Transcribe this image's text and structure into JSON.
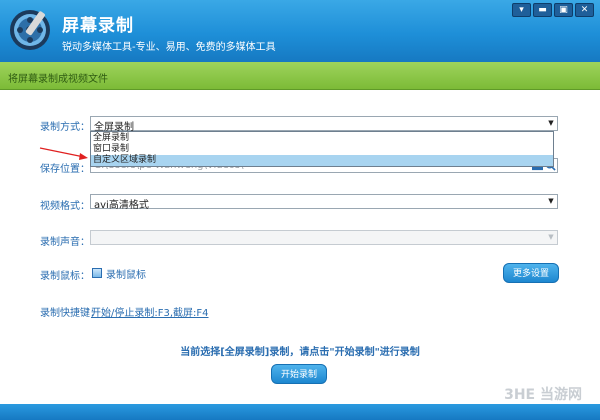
{
  "app": {
    "title": "屏幕录制",
    "subtitle": "锐动多媒体工具-专业、易用、免费的多媒体工具"
  },
  "window_controls": {
    "menu": "▾",
    "minimize": "▬",
    "restore": "▣",
    "close": "✕"
  },
  "section": {
    "title": "将屏幕录制成视频文件"
  },
  "form": {
    "record_mode": {
      "label": "录制方式：",
      "value": "全屏录制",
      "options": [
        "全屏录制",
        "窗口录制",
        "自定义区域录制"
      ],
      "highlighted": "自定义区域录制"
    },
    "save_location": {
      "label": "保存位置：",
      "value": "C:\\Users\\pe Wanweng\\Videos\\"
    },
    "video_format": {
      "label": "视频格式：",
      "value": "avi高清格式"
    },
    "audio": {
      "label": "录制声音：",
      "value": ""
    },
    "cursor": {
      "label": "录制鼠标：",
      "checkbox_label": "录制鼠标",
      "checked": true
    },
    "more_settings_button": "更多设置",
    "hotkey": {
      "label": "录制快捷键：",
      "value": "开始/停止录制:F3,截屏:F4"
    }
  },
  "status_message": "当前选择[全屏录制]录制，请点击\"开始录制\"进行录制",
  "start_button": "开始录制",
  "watermark": "3HE 当游网",
  "colors": {
    "header": "#1e8fd8",
    "section_bar": "#7cbb37",
    "accent": "#2a6db0"
  }
}
